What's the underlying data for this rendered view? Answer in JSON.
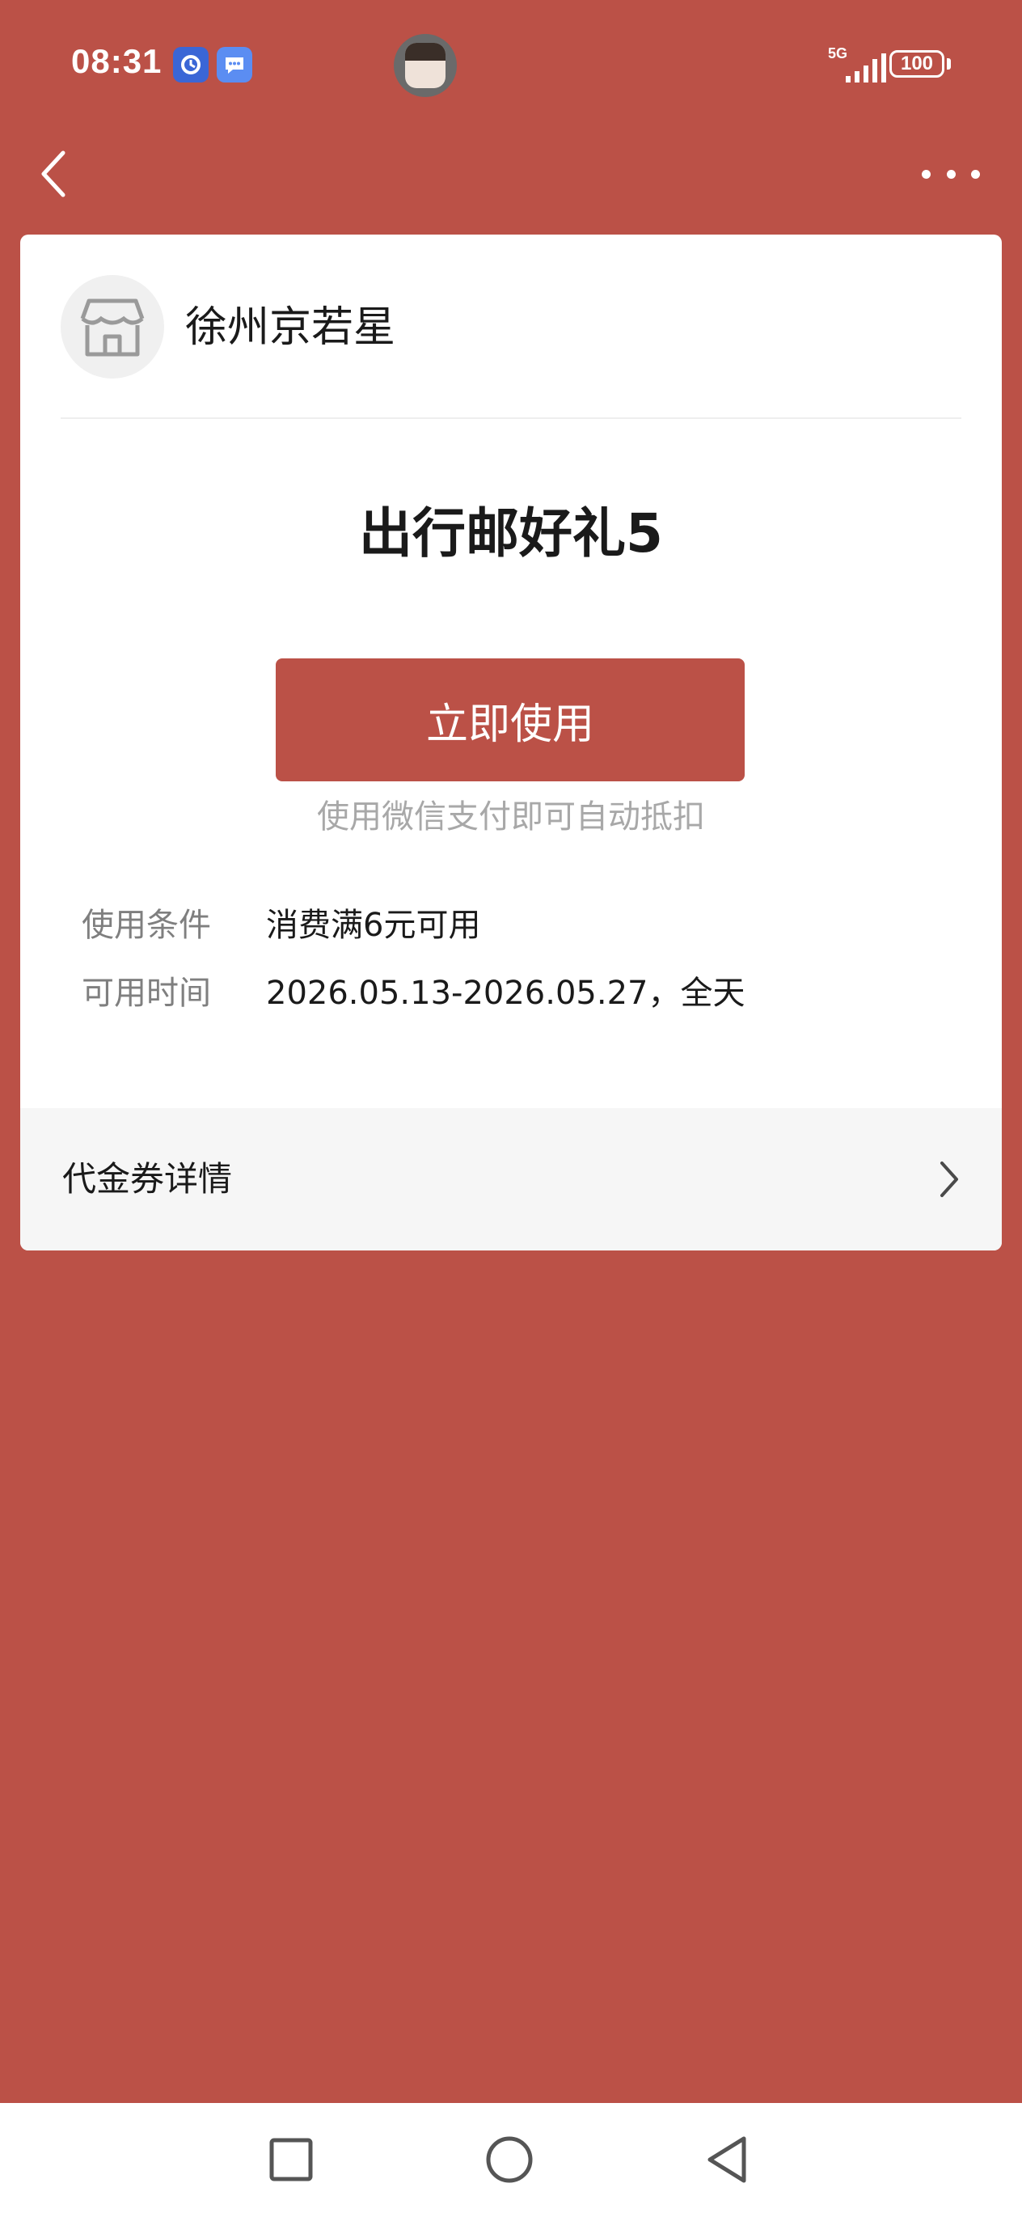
{
  "status_bar": {
    "time": "08:31",
    "network": "5G",
    "battery": "100",
    "notification_icons": [
      "app-notification-icon",
      "message-notification-icon"
    ]
  },
  "nav": {
    "back_icon": "chevron-left-icon",
    "more_icon": "more-dots-icon"
  },
  "merchant": {
    "name": "徐州京若星",
    "avatar_icon": "store-icon"
  },
  "coupon": {
    "title": "出行邮好礼5",
    "use_button_label": "立即使用",
    "use_hint": "使用微信支付即可自动抵扣",
    "conditions_label": "使用条件",
    "conditions_value": "消费满6元可用",
    "time_label": "可用时间",
    "time_value": "2026.05.13-2026.05.27，全天"
  },
  "details": {
    "label": "代金券详情",
    "chevron_icon": "chevron-right-icon"
  },
  "system_nav": {
    "recent_icon": "square-icon",
    "home_icon": "circle-icon",
    "back_icon": "triangle-back-icon"
  },
  "colors": {
    "background": "#bb5147",
    "accent": "#bb5147",
    "card": "#ffffff",
    "hint_text": "#a8a8a8",
    "label_text": "#7f7f7f"
  }
}
